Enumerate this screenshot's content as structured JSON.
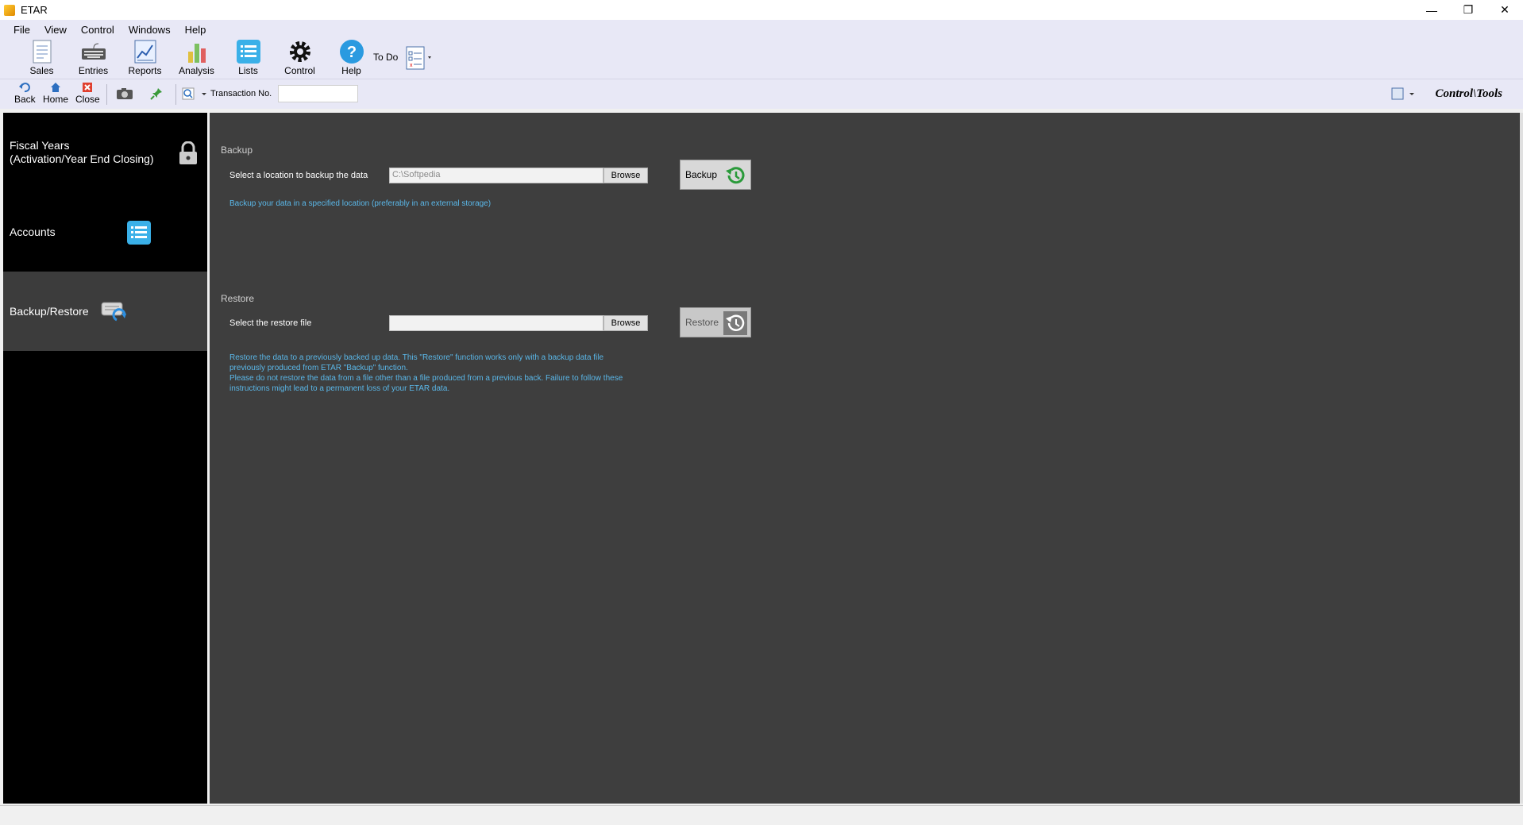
{
  "window": {
    "title": "ETAR"
  },
  "menu": [
    "File",
    "View",
    "Control",
    "Windows",
    "Help"
  ],
  "big_tools": [
    {
      "label": "Sales",
      "icon": "sales-icon"
    },
    {
      "label": "Entries",
      "icon": "keyboard-icon"
    },
    {
      "label": "Reports",
      "icon": "reports-icon"
    },
    {
      "label": "Analysis",
      "icon": "analysis-icon"
    },
    {
      "label": "Lists",
      "icon": "list-icon"
    },
    {
      "label": "Control",
      "icon": "gear-icon"
    },
    {
      "label": "Help",
      "icon": "help-icon"
    }
  ],
  "todo_label": "To Do",
  "small_tools": {
    "back": "Back",
    "home": "Home",
    "close": "Close"
  },
  "transaction_label": "Transaction No.",
  "breadcrumb": "Control\\Tools",
  "nav": [
    {
      "label": "Fiscal Years\n(Activation/Year End Closing)",
      "icon": "lock-icon"
    },
    {
      "label": "Accounts",
      "icon": "list-icon"
    },
    {
      "label": "Backup/Restore",
      "icon": "backup-drive-icon"
    }
  ],
  "backup": {
    "title": "Backup",
    "field_label": "Select a location to backup the data",
    "path_value": "C:\\Softpedia",
    "browse_label": "Browse",
    "button_label": "Backup",
    "info": "Backup your data in a specified location (preferably in an external storage)"
  },
  "restore": {
    "title": "Restore",
    "field_label": "Select the restore file",
    "path_value": "",
    "browse_label": "Browse",
    "button_label": "Restore",
    "info_1": "Restore the data to a previously backed up data. This \"Restore\" function works only with a backup data file",
    "info_2": "previously produced from ETAR \"Backup\" function.",
    "info_3": "Please do not restore the data from a file other than a file produced from a previous back. Failure to follow these",
    "info_4": "instructions might lead to a permanent loss of your ETAR data."
  },
  "colors": {
    "accent": "#5ab7e8",
    "ribbon": "#e8e8f6",
    "main_bg": "#3e3e3e",
    "nav_bg": "#000000"
  }
}
